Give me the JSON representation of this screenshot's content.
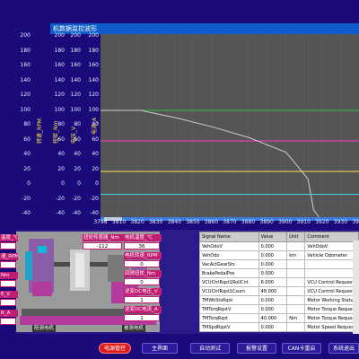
{
  "window": {
    "title": "机数据监控波形"
  },
  "chart_data": {
    "type": "line",
    "x_ticks": [
      "3798",
      "3810",
      "3820",
      "3830",
      "3840",
      "3850",
      "3860",
      "3870",
      "3880",
      "3890",
      "3900",
      "3910",
      "3920",
      "3930",
      "3940"
    ],
    "y_ticks": [
      "200",
      "180",
      "160",
      "140",
      "120",
      "100",
      "80",
      "60",
      "40",
      "20",
      "0",
      "-20",
      "-40"
    ],
    "axis_titles": [
      "转速_RPM",
      "扭矩_Nm",
      "电压_V",
      "电流_A"
    ],
    "ylim": [
      -40,
      200
    ],
    "xlim": [
      3798,
      3940
    ],
    "series": [
      {
        "color": "#2bc44a",
        "x": [
          3798,
          3940
        ],
        "y": [
          100,
          100
        ]
      },
      {
        "color": "#ff3bd1",
        "x": [
          3798,
          3940
        ],
        "y": [
          60,
          60
        ]
      },
      {
        "color": "#cccccc",
        "x": [
          3798,
          3820,
          3840,
          3860,
          3880,
          3900,
          3912,
          3915,
          3918
        ],
        "y": [
          100,
          100,
          90,
          78,
          64,
          45,
          10,
          -30,
          -40
        ]
      },
      {
        "color": "#ffe34a",
        "x": [
          3798,
          3940
        ],
        "y": [
          20,
          20
        ]
      },
      {
        "color": "#3bd7e8",
        "x": [
          3798,
          3940
        ],
        "y": [
          -10,
          -10
        ]
      }
    ]
  },
  "machine": {
    "fields": [
      {
        "label": "温度_℃",
        "value": ""
      },
      {
        "label": "速_RPM",
        "value": ""
      },
      {
        "label": "Nm",
        "value": ""
      },
      {
        "label": "E_V",
        "value": ""
      },
      {
        "label": "R_A",
        "value": ""
      },
      {
        "label": "",
        "value": ""
      },
      {
        "label": "扭矩传感器_Nm",
        "value": "-112"
      },
      {
        "label": "电机温度_℃",
        "value": "36"
      },
      {
        "label": "电机转速_RPM",
        "value": "0"
      },
      {
        "label": "回馈扭矩_Nm",
        "value": "0"
      },
      {
        "label": "逆变DC电压_V",
        "value": "1"
      },
      {
        "label": "逆变DC电流_A",
        "value": "1"
      }
    ],
    "caption_left": "陪测电机",
    "caption_right": "被测电机"
  },
  "signals": {
    "headers": [
      "Signal Name",
      "Value",
      "Unit",
      "Comment"
    ],
    "rows": [
      [
        "VehOdoV",
        "0.000",
        "",
        "VehOdoV"
      ],
      [
        "VehOdo",
        "0.000",
        "km",
        "Vehicle Odometer"
      ],
      [
        "VacActGearSts",
        "0.000",
        "",
        ""
      ],
      [
        "BrakePedalPos",
        "0.000",
        "",
        ""
      ],
      [
        "VCUCtrlRqst1RollCnt",
        "6.000",
        "",
        "VCU Control Request_"
      ],
      [
        "VCUCtrlRqst1Csum",
        "48.000",
        "",
        "VCU Control Request_"
      ],
      [
        "TMWkStsRqst",
        "0.000",
        "",
        "Motor Working Status"
      ],
      [
        "TMTorqRqstV",
        "0.000",
        "",
        "Motor Torque Request"
      ],
      [
        "TMTorqRqst",
        "40.000",
        "Nm",
        "Motor Torque Request"
      ],
      [
        "TMSpdRqstV",
        "0.000",
        "",
        "Motor Speed Request"
      ]
    ]
  },
  "buttons": {
    "power": "电源管控",
    "main": "主界面",
    "auto_test": "自动测试",
    "alarm": "报警设置",
    "can_restart": "CAN卡重启",
    "quit": "系统退出"
  }
}
